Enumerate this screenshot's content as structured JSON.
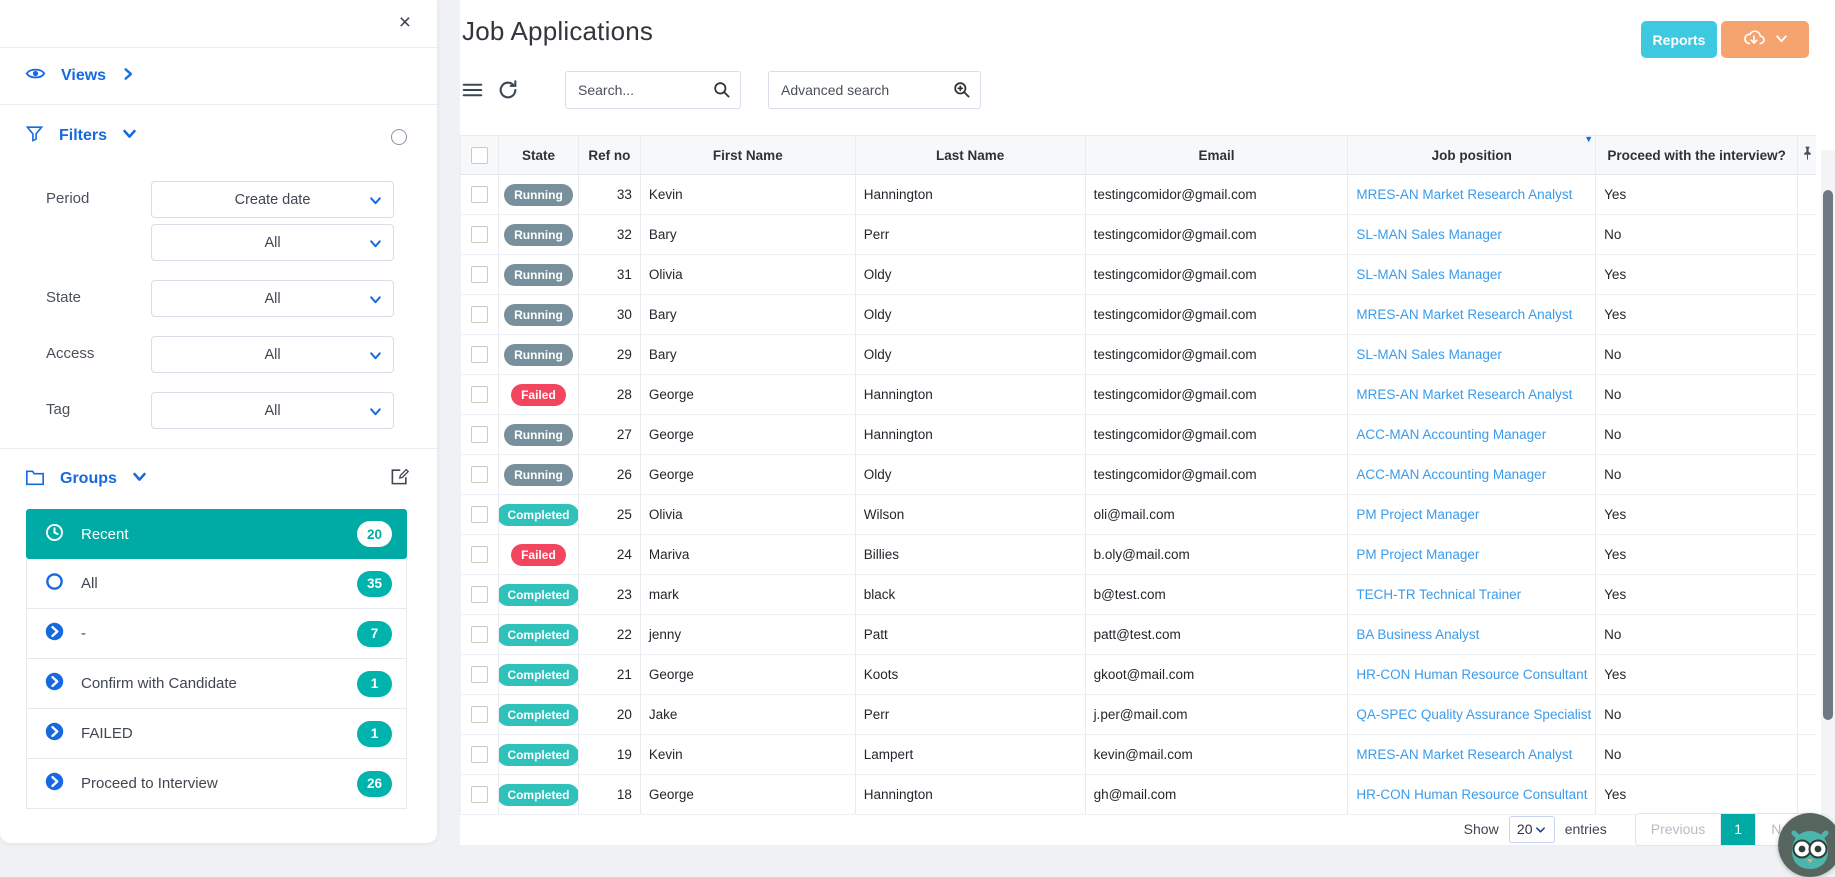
{
  "sidebar": {
    "close_icon": "×",
    "views": {
      "label": "Views"
    },
    "filters": {
      "label": "Filters",
      "fields": [
        {
          "label": "Period",
          "selects": [
            "Create date",
            "All"
          ]
        },
        {
          "label": "State",
          "selects": [
            "All"
          ]
        },
        {
          "label": "Access",
          "selects": [
            "All"
          ]
        },
        {
          "label": "Tag",
          "selects": [
            "All"
          ]
        }
      ]
    },
    "groups": {
      "label": "Groups",
      "items": [
        {
          "label": "Recent",
          "count": "20",
          "icon": "clock-icon",
          "active": true
        },
        {
          "label": "All",
          "count": "35",
          "icon": "circle-icon",
          "active": false
        },
        {
          "label": "-",
          "count": "7",
          "icon": "chevron-circle-right-icon",
          "active": false
        },
        {
          "label": "Confirm with Candidate",
          "count": "1",
          "icon": "chevron-circle-right-icon",
          "active": false
        },
        {
          "label": "FAILED",
          "count": "1",
          "icon": "chevron-circle-right-icon",
          "active": false
        },
        {
          "label": "Proceed to Interview",
          "count": "26",
          "icon": "chevron-circle-right-icon",
          "active": false
        }
      ]
    }
  },
  "header": {
    "title": "Job Applications",
    "reports_button": "Reports"
  },
  "toolbar": {
    "search_placeholder": "Search...",
    "advanced_search_placeholder": "Advanced search",
    "icons": [
      "menu-icon",
      "refresh-icon",
      "search-icon",
      "zoom-in-icon"
    ]
  },
  "table": {
    "columns": [
      "State",
      "Ref no",
      "First Name",
      "Last Name",
      "Email",
      "Job position",
      "Proceed with the interview?"
    ],
    "rows": [
      {
        "state": "Running",
        "ref": "33",
        "first": "Kevin",
        "last": "Hannington",
        "email": "testingcomidor@gmail.com",
        "job": "MRES-AN Market Research Analyst",
        "proceed": "Yes"
      },
      {
        "state": "Running",
        "ref": "32",
        "first": "Bary",
        "last": "Perr",
        "email": "testingcomidor@gmail.com",
        "job": "SL-MAN Sales Manager",
        "proceed": "No"
      },
      {
        "state": "Running",
        "ref": "31",
        "first": "Olivia",
        "last": "Oldy",
        "email": "testingcomidor@gmail.com",
        "job": "SL-MAN Sales Manager",
        "proceed": "Yes"
      },
      {
        "state": "Running",
        "ref": "30",
        "first": "Bary",
        "last": "Oldy",
        "email": "testingcomidor@gmail.com",
        "job": "MRES-AN Market Research Analyst",
        "proceed": "Yes"
      },
      {
        "state": "Running",
        "ref": "29",
        "first": "Bary",
        "last": "Oldy",
        "email": "testingcomidor@gmail.com",
        "job": "SL-MAN Sales Manager",
        "proceed": "No"
      },
      {
        "state": "Failed",
        "ref": "28",
        "first": "George",
        "last": "Hannington",
        "email": "testingcomidor@gmail.com",
        "job": "MRES-AN Market Research Analyst",
        "proceed": "No"
      },
      {
        "state": "Running",
        "ref": "27",
        "first": "George",
        "last": "Hannington",
        "email": "testingcomidor@gmail.com",
        "job": "ACC-MAN Accounting Manager",
        "proceed": "No"
      },
      {
        "state": "Running",
        "ref": "26",
        "first": "George",
        "last": "Oldy",
        "email": "testingcomidor@gmail.com",
        "job": "ACC-MAN Accounting Manager",
        "proceed": "No"
      },
      {
        "state": "Completed",
        "ref": "25",
        "first": "Olivia",
        "last": "Wilson",
        "email": "oli@mail.com",
        "job": "PM Project Manager",
        "proceed": "Yes"
      },
      {
        "state": "Failed",
        "ref": "24",
        "first": "Mariva",
        "last": "Billies",
        "email": "b.oly@mail.com",
        "job": "PM Project Manager",
        "proceed": "Yes"
      },
      {
        "state": "Completed",
        "ref": "23",
        "first": "mark",
        "last": "black",
        "email": "b@test.com",
        "job": "TECH-TR Technical Trainer",
        "proceed": "Yes"
      },
      {
        "state": "Completed",
        "ref": "22",
        "first": "jenny",
        "last": "Patt",
        "email": "patt@test.com",
        "job": "BA Business Analyst",
        "proceed": "No"
      },
      {
        "state": "Completed",
        "ref": "21",
        "first": "George",
        "last": "Koots",
        "email": "gkoot@mail.com",
        "job": "HR-CON Human Resource Consultant",
        "proceed": "Yes"
      },
      {
        "state": "Completed",
        "ref": "20",
        "first": "Jake",
        "last": "Perr",
        "email": "j.per@mail.com",
        "job": "QA-SPEC Quality Assurance Specialist",
        "proceed": "No"
      },
      {
        "state": "Completed",
        "ref": "19",
        "first": "Kevin",
        "last": "Lampert",
        "email": "kevin@mail.com",
        "job": "MRES-AN Market Research Analyst",
        "proceed": "No"
      },
      {
        "state": "Completed",
        "ref": "18",
        "first": "George",
        "last": "Hannington",
        "email": "gh@mail.com",
        "job": "HR-CON Human Resource Consultant",
        "proceed": "Yes"
      }
    ]
  },
  "pagination": {
    "show_label": "Show",
    "page_size": "20",
    "entries_label": "entries",
    "previous_label": "Previous",
    "current_page": "1",
    "next_label": "Next"
  },
  "colors": {
    "accent_blue": "#1769e0",
    "teal_active": "#00aba5",
    "badge_teal": "#00b3ac",
    "reports_button": "#3ec9e0",
    "export_button": "#f5a470",
    "job_link": "#3c9bea",
    "state_badges": {
      "Running": "#78909c",
      "Failed": "#f4455f",
      "Completed": "#2fc1ba"
    }
  }
}
